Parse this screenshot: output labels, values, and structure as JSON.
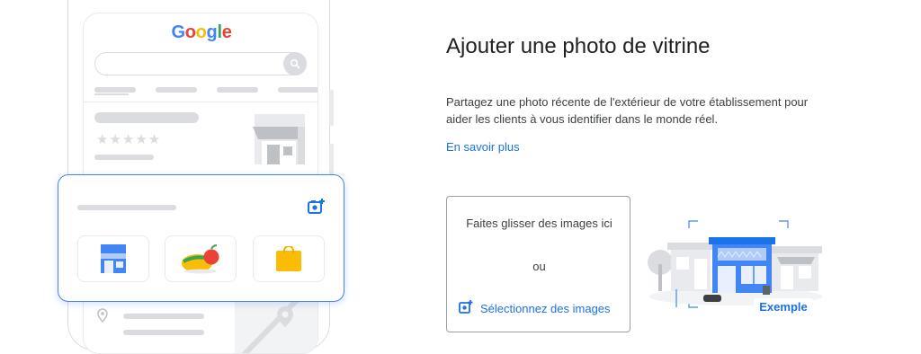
{
  "illustration": {
    "google_logo": {
      "G": "G",
      "o1": "o",
      "o2": "o",
      "g": "g",
      "l": "l",
      "e": "e"
    },
    "stars": "★★★★★",
    "colors": {
      "blue": "#4285f4",
      "red": "#ea4335",
      "yellow": "#fbbc05",
      "green": "#34a853",
      "grey": "#dadce0"
    }
  },
  "main": {
    "title": "Ajouter une photo de vitrine",
    "description": "Partagez une photo récente de l'extérieur de votre établissement pour aider les clients à vous identifier dans le monde réel.",
    "learn_more": "En savoir plus",
    "dropzone": {
      "drag_text": "Faites glisser des images ici",
      "or_text": "ou",
      "select_label": "Sélectionnez des images"
    },
    "example_label": "Exemple"
  }
}
